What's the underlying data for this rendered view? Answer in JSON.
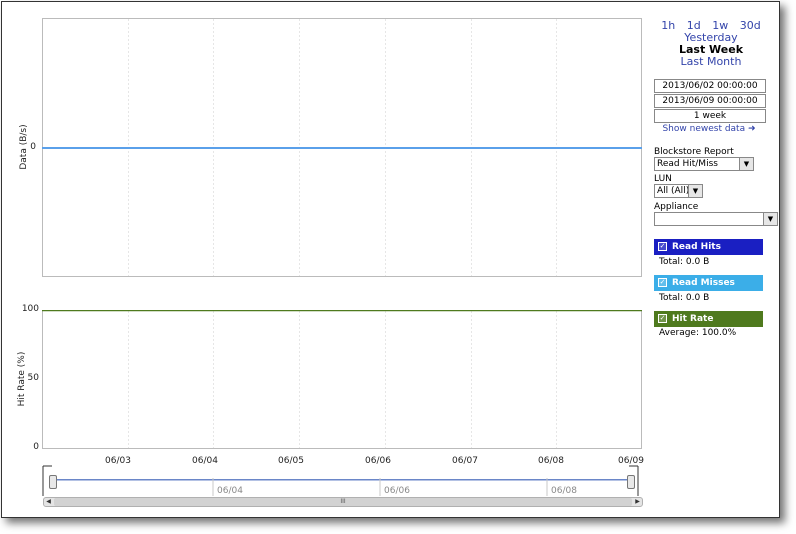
{
  "top_chart": {
    "ylabel": "Data (B/s)",
    "yticks": [
      "0"
    ]
  },
  "bottom_chart": {
    "ylabel": "Hit Rate (%)",
    "yticks": [
      "100",
      "50",
      "0"
    ]
  },
  "xticks": [
    "06/03",
    "06/04",
    "06/05",
    "06/06",
    "06/07",
    "06/08",
    "06/09"
  ],
  "scroller": {
    "labels": [
      "06/04",
      "06/06",
      "06/08"
    ],
    "thumb_label": "III"
  },
  "ranges": {
    "quick": [
      "1h",
      "1d",
      "1w",
      "30d"
    ],
    "yesterday": "Yesterday",
    "last_week": "Last Week",
    "last_month": "Last Month"
  },
  "period": {
    "start": "2013/06/02 00:00:00",
    "end": "2013/06/09 00:00:00",
    "duration": "1 week",
    "show_newest": "Show newest data ➜"
  },
  "filters": {
    "report_label": "Blockstore Report",
    "report_value": "Read Hit/Miss",
    "lun_label": "LUN",
    "lun_value": "All (All)",
    "appliance_label": "Appliance",
    "appliance_value": ""
  },
  "legend": [
    {
      "label": "Read Hits",
      "sub": "Total:  0.0 B",
      "color": "#1a1fc2"
    },
    {
      "label": "Read Misses",
      "sub": "Total:  0.0 B",
      "color": "#3baee8"
    },
    {
      "label": "Hit Rate",
      "sub": "Average:  100.0%",
      "color": "#4f7a1e"
    }
  ],
  "chart_data": [
    {
      "type": "line",
      "ylabel": "Data (B/s)",
      "x": [
        "06/02",
        "06/09"
      ],
      "series": [
        {
          "name": "Read Hits",
          "values": [
            0,
            0
          ]
        },
        {
          "name": "Read Misses",
          "values": [
            0,
            0
          ]
        }
      ],
      "grid": true
    },
    {
      "type": "line",
      "ylabel": "Hit Rate (%)",
      "x": [
        "06/02",
        "06/09"
      ],
      "series": [
        {
          "name": "Hit Rate",
          "values": [
            100,
            100
          ]
        }
      ],
      "ylim": [
        0,
        100
      ],
      "grid": true
    }
  ]
}
